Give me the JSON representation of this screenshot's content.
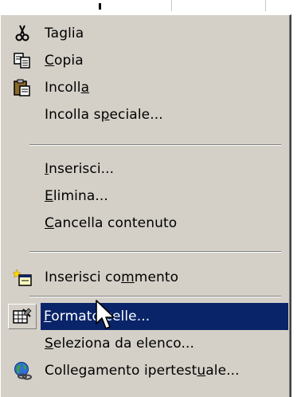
{
  "menu": {
    "items": [
      {
        "id": "taglia",
        "before": "",
        "ul": "",
        "after": "Taglia",
        "icon": "scissors-icon"
      },
      {
        "id": "copia",
        "before": "",
        "ul": "C",
        "after": "opia",
        "icon": "copy-icon"
      },
      {
        "id": "incolla",
        "before": "Incoll",
        "ul": "a",
        "after": "",
        "icon": "paste-icon"
      },
      {
        "id": "incolla-speciale",
        "before": "Incolla s",
        "ul": "p",
        "after": "eciale...",
        "icon": ""
      },
      {
        "id": "inserisci",
        "before": "",
        "ul": "I",
        "after": "nserisci...",
        "icon": ""
      },
      {
        "id": "elimina",
        "before": "",
        "ul": "E",
        "after": "limina...",
        "icon": ""
      },
      {
        "id": "cancella-contenuto",
        "before": "",
        "ul": "C",
        "after": "ancella contenuto",
        "icon": ""
      },
      {
        "id": "inserisci-commento",
        "before": "Inserisci co",
        "ul": "m",
        "after": "mento",
        "icon": "new-comment-icon"
      },
      {
        "id": "formato-celle",
        "before": "",
        "ul": "F",
        "after": "ormato celle...",
        "icon": "format-cells-icon",
        "highlighted": true
      },
      {
        "id": "seleziona-da-elenco",
        "before": "",
        "ul": "S",
        "after": "eleziona da elenco...",
        "icon": ""
      },
      {
        "id": "collegamento",
        "before": "Collegamento ipertest",
        "ul": "u",
        "after": "ale...",
        "icon": "hyperlink-globe-icon"
      }
    ]
  },
  "colors": {
    "menu_bg": "#d4d0c8",
    "highlight_bg": "#0a246a",
    "highlight_text": "#ffffff"
  }
}
